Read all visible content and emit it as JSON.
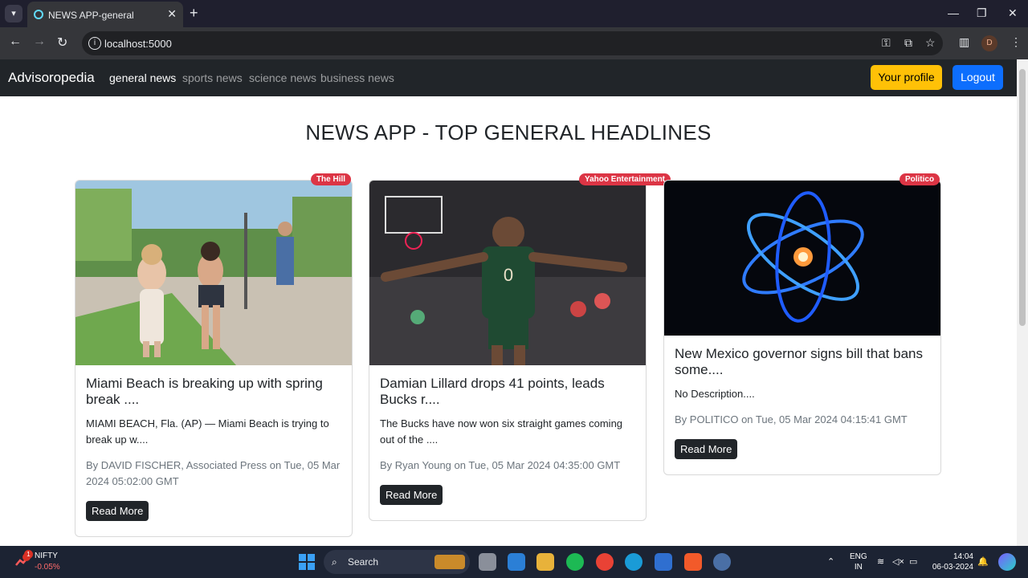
{
  "browser": {
    "tab_title": "NEWS APP-general",
    "url": "localhost:5000",
    "profile_initial": "D"
  },
  "app": {
    "brand": "Advisoropedia",
    "nav": [
      "general news",
      "sports news",
      "science news",
      "business news"
    ],
    "profile_label": "Your profile",
    "logout_label": "Logout",
    "heading": "NEWS APP - TOP GENERAL HEADLINES"
  },
  "articles": [
    {
      "source": "The Hill",
      "title": "Miami Beach is breaking up with spring break ....",
      "description": "MIAMI BEACH, Fla. (AP) — Miami Beach is trying to break up w....",
      "meta": "By DAVID FISCHER, Associated Press on Tue, 05 Mar 2024 05:02:00 GMT",
      "button": "Read More"
    },
    {
      "source": "Yahoo Entertainment",
      "title": "Damian Lillard drops 41 points, leads Bucks r....",
      "description": "The Bucks have now won six straight games coming out of the ....",
      "meta": "By Ryan Young on Tue, 05 Mar 2024 04:35:00 GMT",
      "button": "Read More"
    },
    {
      "source": "Politico",
      "title": "New Mexico governor signs bill that bans some....",
      "description": "No Description....",
      "meta": "By POLITICO on Tue, 05 Mar 2024 04:15:41 GMT",
      "button": "Read More"
    }
  ],
  "taskbar": {
    "ticker_name": "NIFTY",
    "ticker_change": "-0.05%",
    "ticker_badge": "1",
    "search_label": "Search",
    "lang_1": "ENG",
    "lang_2": "IN",
    "time": "14:04",
    "date": "06-03-2024"
  },
  "colors": {
    "navbar": "#212529",
    "profile_btn": "#ffc107",
    "logout_btn": "#0d6efd",
    "badge": "#dc3545"
  }
}
